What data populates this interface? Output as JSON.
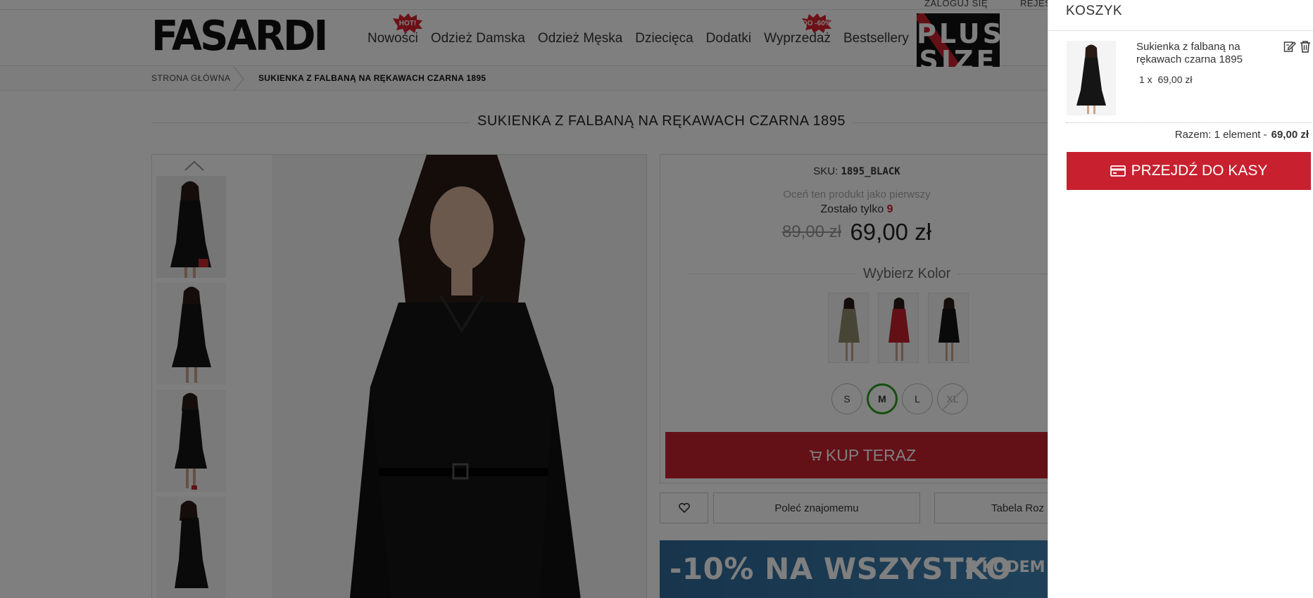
{
  "topbar": {
    "login": "ZALOGUJ SIĘ",
    "register": "REJES"
  },
  "header": {
    "logo": "FASARDI",
    "nav": [
      {
        "label": "Nowości",
        "badge": "HOT!"
      },
      {
        "label": "Odzież Damska"
      },
      {
        "label": "Odzież Męska"
      },
      {
        "label": "Dziecięca"
      },
      {
        "label": "Dodatki"
      },
      {
        "label": "Wyprzedaż",
        "badge": "DO -60%"
      },
      {
        "label": "Bestsellery"
      }
    ],
    "plus_size": {
      "line1": "PLUS",
      "line2": "SIZE"
    }
  },
  "breadcrumb": {
    "home": "STRONA GŁÓWNA",
    "current": "SUKIENKA Z FALBANĄ NA RĘKAWACH CZARNA 1895"
  },
  "product": {
    "title": "SUKIENKA Z FALBANĄ NA RĘKAWACH CZARNA 1895",
    "sku_label": "SKU:",
    "sku": "1895_BLACK",
    "rating_prompt": "Oceń ten produkt jako pierwszy",
    "stock_label": "Zostało tylko",
    "stock_count": "9",
    "old_price": "89,00 zł",
    "price": "69,00 zł",
    "color_heading": "Wybierz Kolor",
    "sizes": [
      "S",
      "M",
      "L",
      "XL"
    ],
    "selected_size": "M",
    "buy_label": "KUP TERAZ",
    "recommend_label": "Poleć znajomemu",
    "size_table_label": "Tabela Roz"
  },
  "promo": {
    "big": "-10% NA WSZYSTKO",
    "small": "Z KODEM"
  },
  "cart": {
    "title": "KOSZYK",
    "item_name": "Sukienka z falbaną na rękawach czarna 1895",
    "item_qty": "1 x",
    "item_price": "69,00 zł",
    "total_label": "Razem: 1 element -",
    "total_value": "69,00 zł",
    "checkout_label": "PRZEJDŹ DO KASY"
  },
  "colors": {
    "accent": "#c8202f",
    "size_selected": "#2a9d1f",
    "promo": "#3a7bad"
  }
}
